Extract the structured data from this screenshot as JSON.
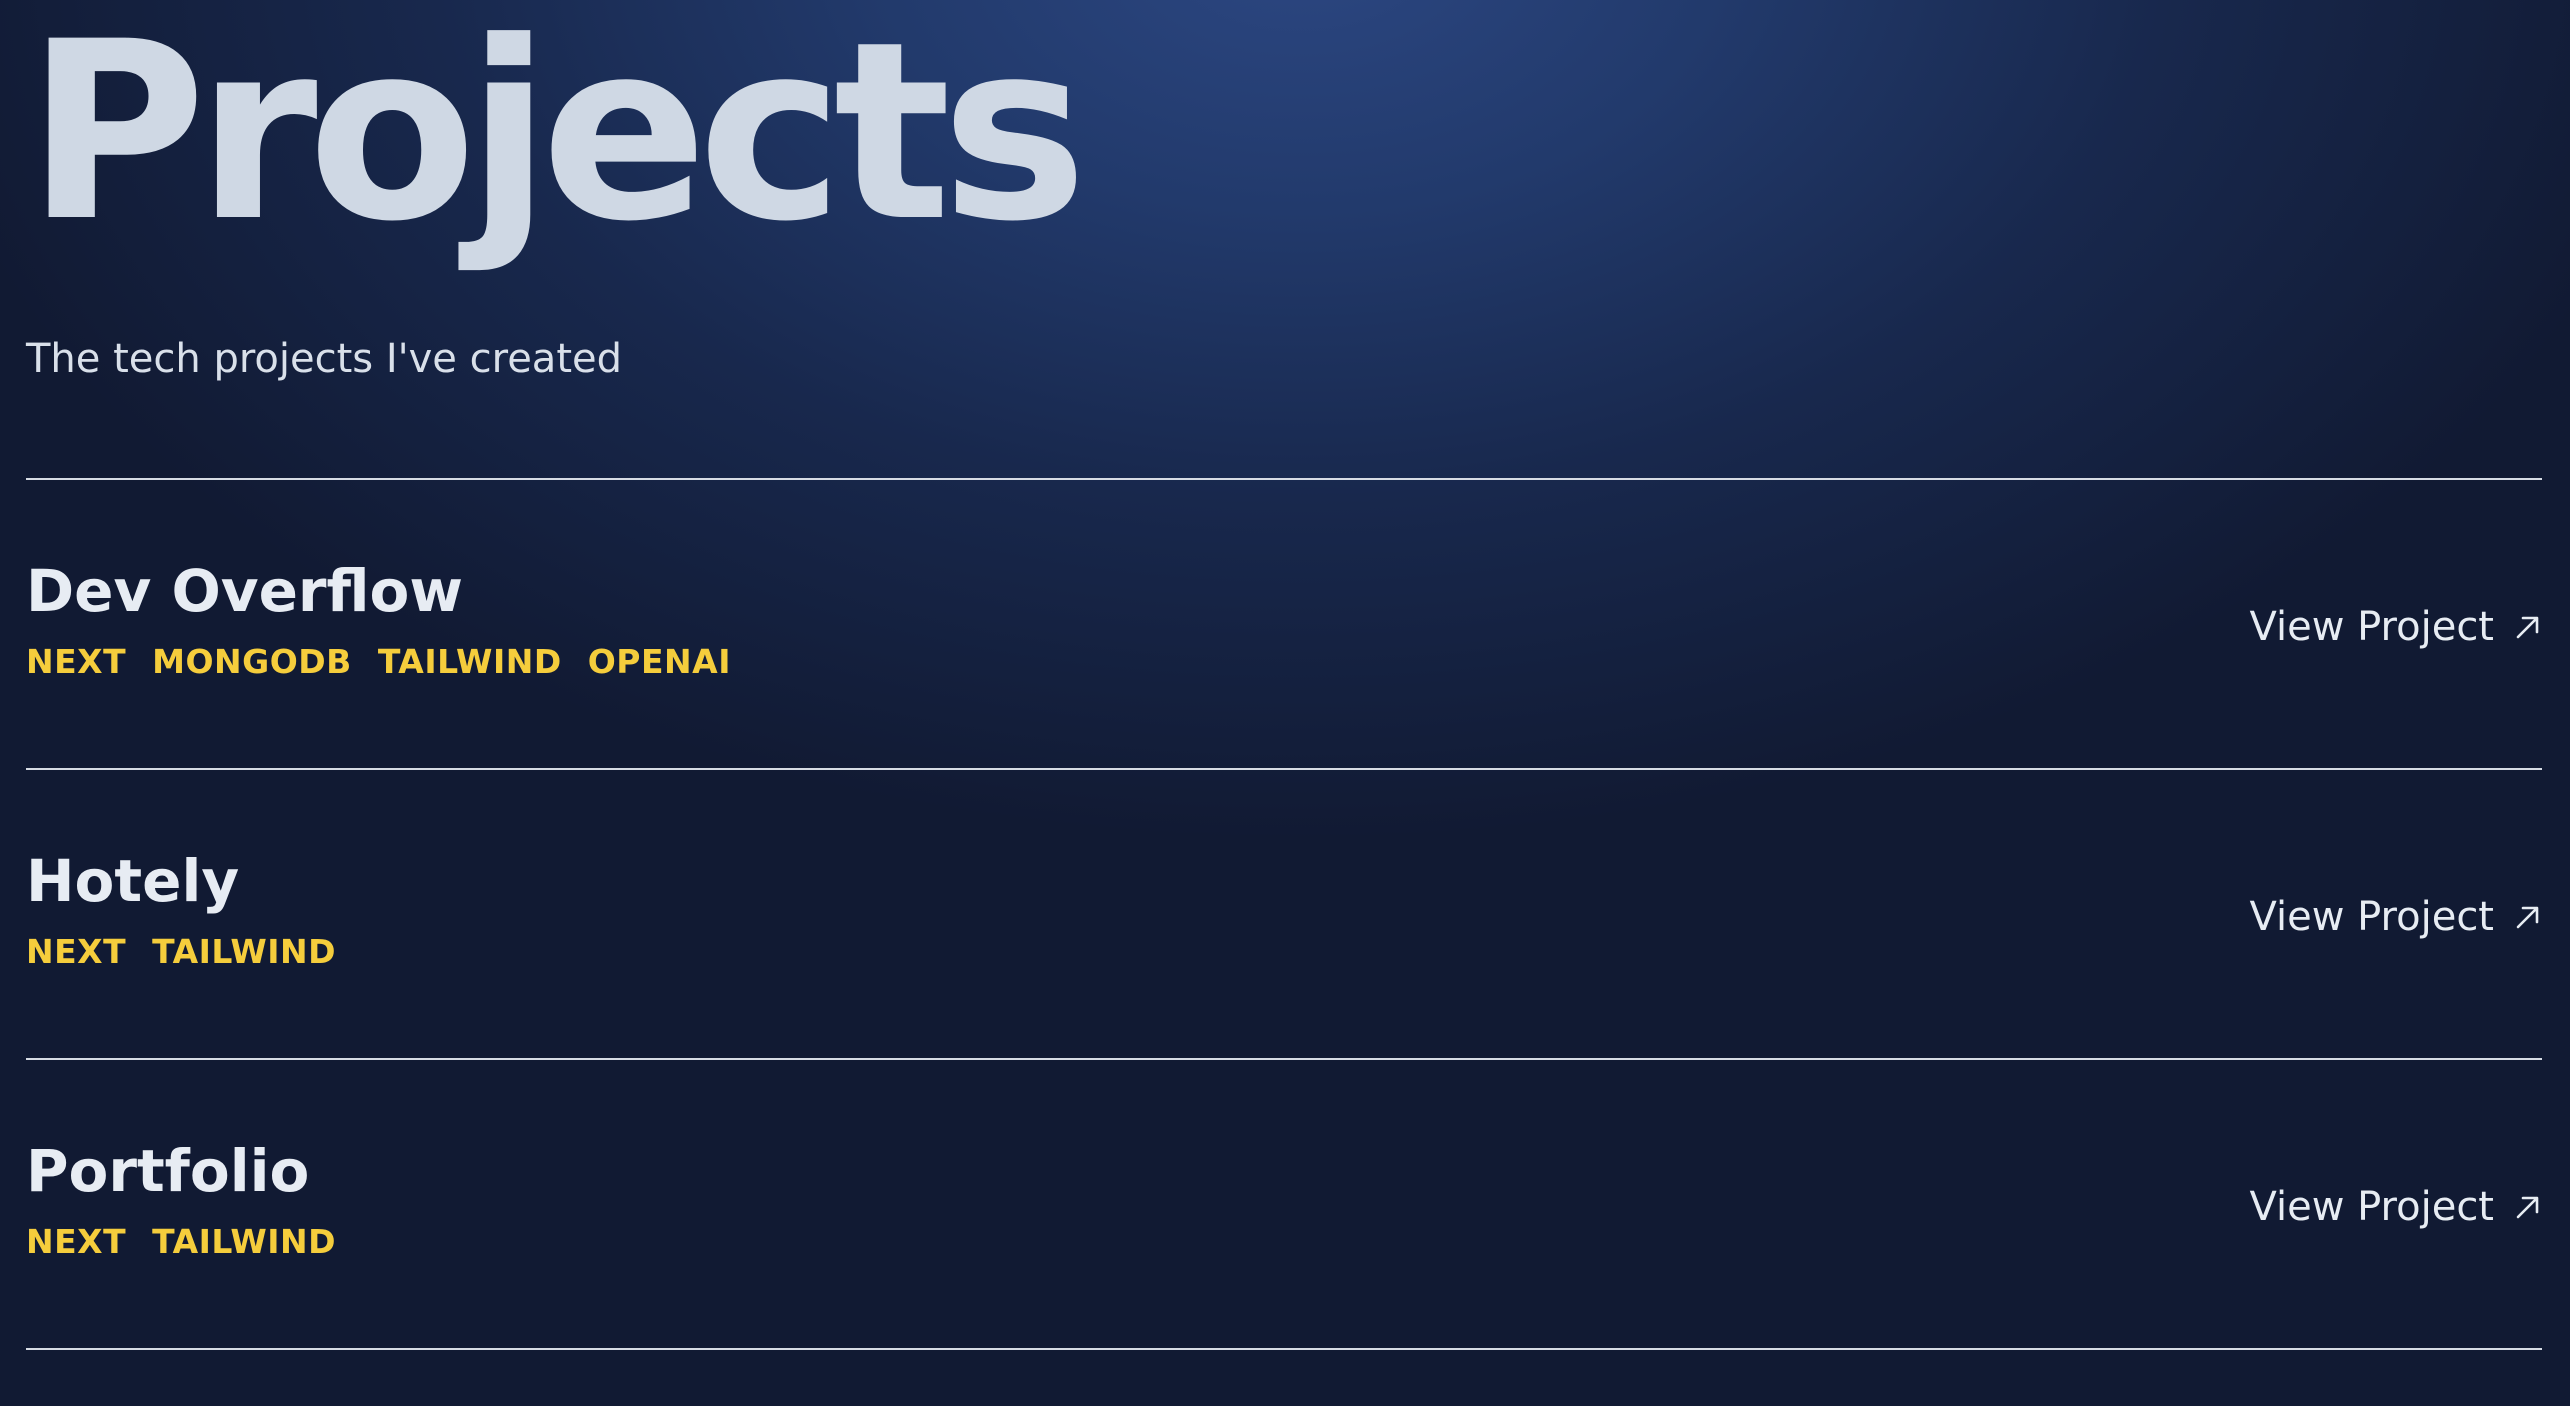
{
  "header": {
    "title": "Projects",
    "subtitle": "The tech projects I've created"
  },
  "projects": [
    {
      "name": "Dev Overflow",
      "tags": [
        "NEXT",
        "MONGODB",
        "TAILWIND",
        "OPENAI"
      ],
      "link_label": "View Project",
      "link_icon": "arrow-up-right-icon"
    },
    {
      "name": "Hotely",
      "tags": [
        "NEXT",
        "TAILWIND"
      ],
      "link_label": "View Project",
      "link_icon": "arrow-up-right-icon"
    },
    {
      "name": "Portfolio",
      "tags": [
        "NEXT",
        "TAILWIND"
      ],
      "link_label": "View Project",
      "link_icon": "arrow-up-right-icon"
    }
  ],
  "colors": {
    "background": "#18284d",
    "accent_tag": "#f5cd3c",
    "text": "#e7ecf3",
    "divider": "#d7dce4"
  }
}
